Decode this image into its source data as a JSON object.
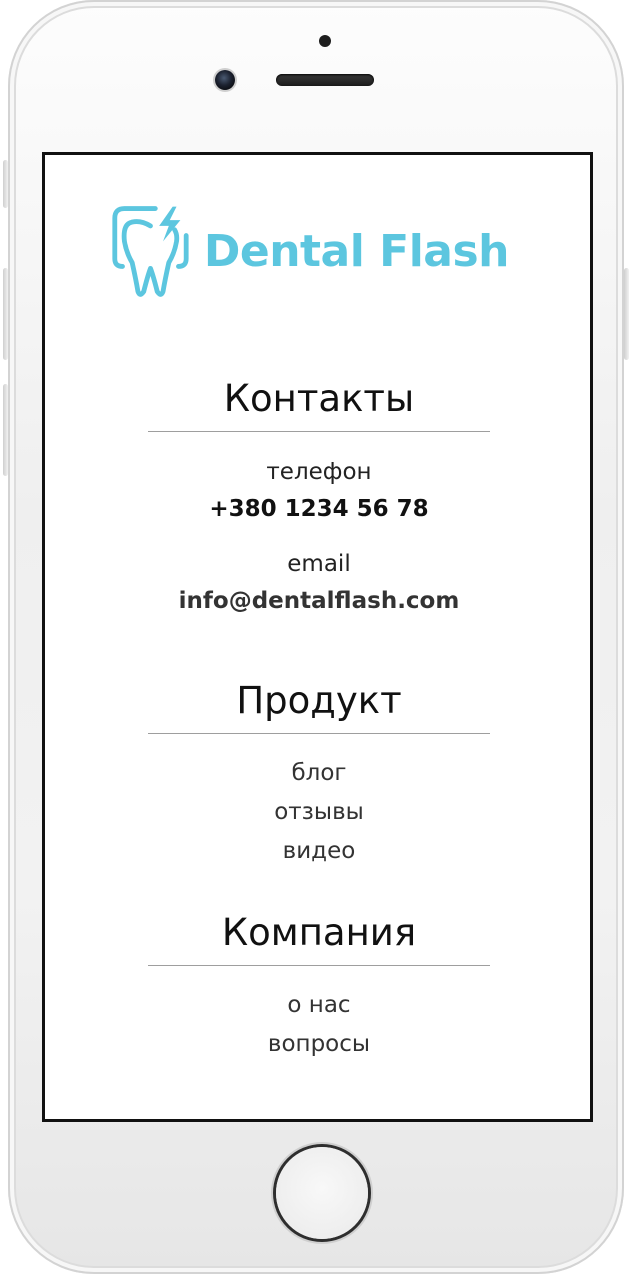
{
  "brand": {
    "name": "Dental Flash",
    "color": "#5cc6df"
  },
  "contacts": {
    "title": "Контакты",
    "phone_label": "телефон",
    "phone_value": "+380 1234 56 78",
    "email_label": "email",
    "email_value": "info@dentalflash.com"
  },
  "product": {
    "title": "Продукт",
    "links": [
      "блог",
      "отзывы",
      "видео"
    ]
  },
  "company": {
    "title": "Компания",
    "links": [
      "о нас",
      "вопросы"
    ]
  }
}
